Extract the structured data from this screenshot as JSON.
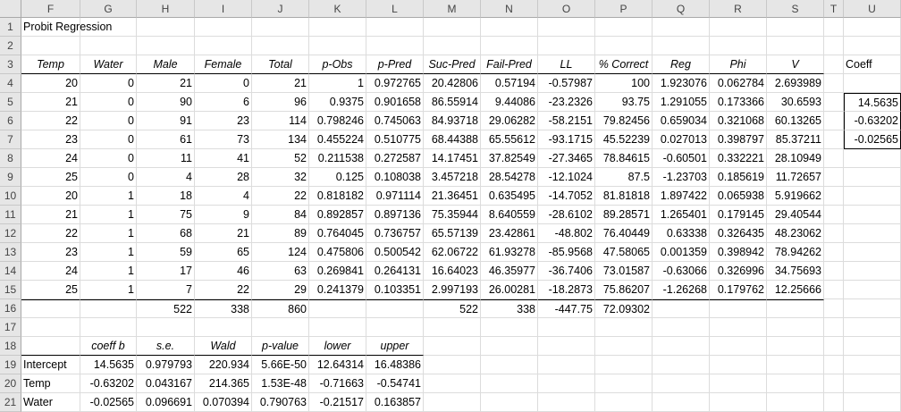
{
  "columns": [
    "F",
    "G",
    "H",
    "I",
    "J",
    "K",
    "L",
    "M",
    "N",
    "O",
    "P",
    "Q",
    "R",
    "S",
    "T",
    "U"
  ],
  "rows": [
    "1",
    "2",
    "3",
    "4",
    "5",
    "6",
    "7",
    "8",
    "9",
    "10",
    "11",
    "12",
    "13",
    "14",
    "15",
    "16",
    "17",
    "18",
    "19",
    "20",
    "21"
  ],
  "title": "Probit Regression",
  "headers": [
    "Temp",
    "Water",
    "Male",
    "Female",
    "Total",
    "p-Obs",
    "p-Pred",
    "Suc-Pred",
    "Fail-Pred",
    "LL",
    "% Correct",
    "Reg",
    "Phi",
    "V"
  ],
  "coeff_label": "Coeff",
  "data_rows": [
    [
      "20",
      "0",
      "21",
      "0",
      "21",
      "1",
      "0.972765",
      "20.42806",
      "0.57194",
      "-0.57987",
      "100",
      "1.923076",
      "0.062784",
      "2.693989"
    ],
    [
      "21",
      "0",
      "90",
      "6",
      "96",
      "0.9375",
      "0.901658",
      "86.55914",
      "9.44086",
      "-23.2326",
      "93.75",
      "1.291055",
      "0.173366",
      "30.6593"
    ],
    [
      "22",
      "0",
      "91",
      "23",
      "114",
      "0.798246",
      "0.745063",
      "84.93718",
      "29.06282",
      "-58.2151",
      "79.82456",
      "0.659034",
      "0.321068",
      "60.13265"
    ],
    [
      "23",
      "0",
      "61",
      "73",
      "134",
      "0.455224",
      "0.510775",
      "68.44388",
      "65.55612",
      "-93.1715",
      "45.52239",
      "0.027013",
      "0.398797",
      "85.37211"
    ],
    [
      "24",
      "0",
      "11",
      "41",
      "52",
      "0.211538",
      "0.272587",
      "14.17451",
      "37.82549",
      "-27.3465",
      "78.84615",
      "-0.60501",
      "0.332221",
      "28.10949"
    ],
    [
      "25",
      "0",
      "4",
      "28",
      "32",
      "0.125",
      "0.108038",
      "3.457218",
      "28.54278",
      "-12.1024",
      "87.5",
      "-1.23703",
      "0.185619",
      "11.72657"
    ],
    [
      "20",
      "1",
      "18",
      "4",
      "22",
      "0.818182",
      "0.971114",
      "21.36451",
      "0.635495",
      "-14.7052",
      "81.81818",
      "1.897422",
      "0.065938",
      "5.919662"
    ],
    [
      "21",
      "1",
      "75",
      "9",
      "84",
      "0.892857",
      "0.897136",
      "75.35944",
      "8.640559",
      "-28.6102",
      "89.28571",
      "1.265401",
      "0.179145",
      "29.40544"
    ],
    [
      "22",
      "1",
      "68",
      "21",
      "89",
      "0.764045",
      "0.736757",
      "65.57139",
      "23.42861",
      "-48.802",
      "76.40449",
      "0.63338",
      "0.326435",
      "48.23062"
    ],
    [
      "23",
      "1",
      "59",
      "65",
      "124",
      "0.475806",
      "0.500542",
      "62.06722",
      "61.93278",
      "-85.9568",
      "47.58065",
      "0.001359",
      "0.398942",
      "78.94262"
    ],
    [
      "24",
      "1",
      "17",
      "46",
      "63",
      "0.269841",
      "0.264131",
      "16.64023",
      "46.35977",
      "-36.7406",
      "73.01587",
      "-0.63066",
      "0.326996",
      "34.75693"
    ],
    [
      "25",
      "1",
      "7",
      "22",
      "29",
      "0.241379",
      "0.103351",
      "2.997193",
      "26.00281",
      "-18.2873",
      "75.86207",
      "-1.26268",
      "0.179762",
      "12.25666"
    ]
  ],
  "coeff_values": [
    "14.5635",
    "-0.63202",
    "-0.02565"
  ],
  "totals": {
    "male": "522",
    "female": "338",
    "total": "860",
    "suc": "522",
    "fail": "338",
    "ll": "-447.75",
    "pct": "72.09302"
  },
  "stats_headers": [
    "coeff b",
    "s.e.",
    "Wald",
    "p-value",
    "lower",
    "upper"
  ],
  "stats_rows": [
    {
      "label": "Intercept",
      "values": [
        "14.5635",
        "0.979793",
        "220.934",
        "5.66E-50",
        "12.64314",
        "16.48386"
      ]
    },
    {
      "label": "Temp",
      "values": [
        "-0.63202",
        "0.043167",
        "214.365",
        "1.53E-48",
        "-0.71663",
        "-0.54741"
      ]
    },
    {
      "label": "Water",
      "values": [
        "-0.02565",
        "0.096691",
        "0.070394",
        "0.790763",
        "-0.21517",
        "0.163857"
      ]
    }
  ]
}
